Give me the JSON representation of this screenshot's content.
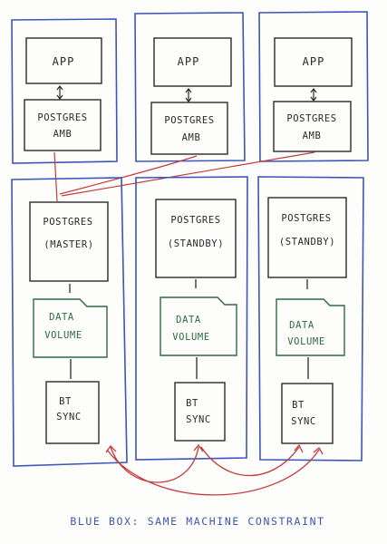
{
  "colors": {
    "blue_box": "#3d56b8",
    "ink": "#2a2a2a",
    "data_volume": "#2f6b3f",
    "red_link": "#c83a3a",
    "paper": "#fdfdfc"
  },
  "top_nodes": [
    {
      "app_label": "APP",
      "proxy_line1": "POSTGRES",
      "proxy_line2": "AMB"
    },
    {
      "app_label": "APP",
      "proxy_line1": "POSTGRES",
      "proxy_line2": "AMB"
    },
    {
      "app_label": "APP",
      "proxy_line1": "POSTGRES",
      "proxy_line2": "AMB"
    }
  ],
  "db_nodes": [
    {
      "db_line1": "POSTGRES",
      "db_line2": "(MASTER)",
      "volume_line1": "DATA",
      "volume_line2": "VOLUME",
      "sync_line1": "BT",
      "sync_line2": "SYNC"
    },
    {
      "db_line1": "POSTGRES",
      "db_line2": "(STANDBY)",
      "volume_line1": "DATA",
      "volume_line2": "VOLUME",
      "sync_line1": "BT",
      "sync_line2": "SYNC"
    },
    {
      "db_line1": "POSTGRES",
      "db_line2": "(STANDBY)",
      "volume_line1": "DATA",
      "volume_line2": "VOLUME",
      "sync_line1": "BT",
      "sync_line2": "SYNC"
    }
  ],
  "caption": "BLUE BOX: SAME MACHINE CONSTRAINT"
}
